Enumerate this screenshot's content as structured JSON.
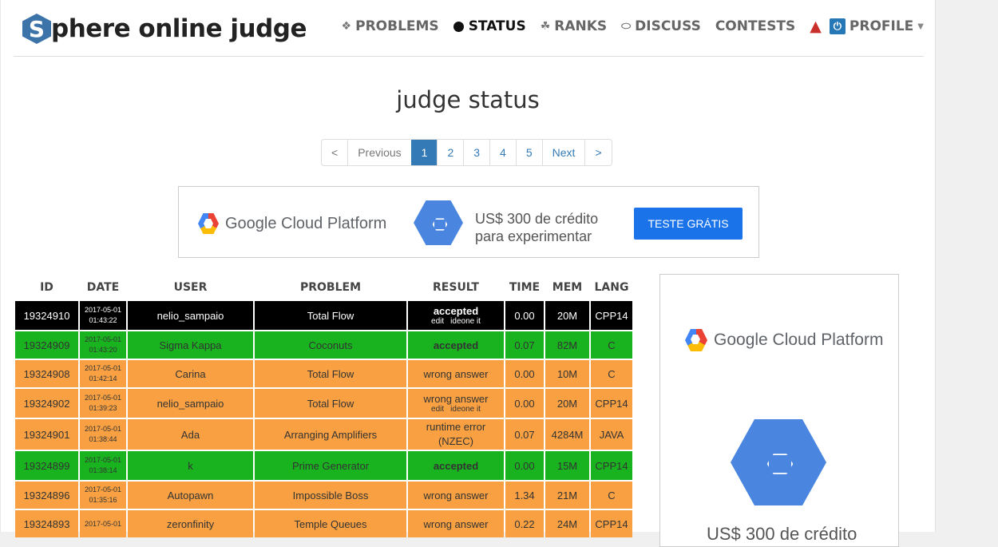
{
  "logo": {
    "letter": "S",
    "text": "phere online judge"
  },
  "nav": [
    {
      "label": "PROBLEMS",
      "icon": "puzzle-icon"
    },
    {
      "label": "STATUS",
      "icon": "dot-icon",
      "active": true
    },
    {
      "label": "RANKS",
      "icon": "trophy-icon"
    },
    {
      "label": "DISCUSS",
      "icon": "comments-icon"
    },
    {
      "label": "CONTESTS",
      "icon": ""
    },
    {
      "label": "PROFILE",
      "icon": "power-icon"
    }
  ],
  "title": "judge status",
  "pagination": [
    "<",
    "Previous",
    "1",
    "2",
    "3",
    "4",
    "5",
    "Next",
    ">"
  ],
  "ad_banner": {
    "brand": "Google Cloud Platform",
    "line1": "US$ 300 de crédito",
    "line2": "para experimentar",
    "cta": "TESTE GRÁTIS"
  },
  "ad_side": {
    "brand": "Google Cloud Platform",
    "line1": "US$ 300 de crédito"
  },
  "table": {
    "headers": [
      "ID",
      "DATE",
      "USER",
      "PROBLEM",
      "RESULT",
      "TIME",
      "MEM",
      "LANG"
    ],
    "rows": [
      {
        "id": "19324910",
        "date": "2017-05-01",
        "time_of_day": "01:43:22",
        "user": "nelio_sampaio",
        "problem": "Total Flow",
        "result": "accepted",
        "links": [
          "edit",
          "ideone it"
        ],
        "time": "0.00",
        "mem": "20M",
        "lang": "CPP14",
        "color": "black"
      },
      {
        "id": "19324909",
        "date": "2017-05-01",
        "time_of_day": "01:43:20",
        "user": "Sigma Kappa",
        "problem": "Coconuts",
        "result": "accepted",
        "links": [],
        "time": "0.07",
        "mem": "82M",
        "lang": "C",
        "color": "green"
      },
      {
        "id": "19324908",
        "date": "2017-05-01",
        "time_of_day": "01:42:14",
        "user": "Carina",
        "problem": "Total Flow",
        "result": "wrong answer",
        "links": [],
        "time": "0.00",
        "mem": "10M",
        "lang": "C",
        "color": "orange"
      },
      {
        "id": "19324902",
        "date": "2017-05-01",
        "time_of_day": "01:39:23",
        "user": "nelio_sampaio",
        "problem": "Total Flow",
        "result": "wrong answer",
        "links": [
          "edit",
          "ideone it"
        ],
        "time": "0.00",
        "mem": "20M",
        "lang": "CPP14",
        "color": "orange"
      },
      {
        "id": "19324901",
        "date": "2017-05-01",
        "time_of_day": "01:38:44",
        "user": "Ada",
        "problem": "Arranging Amplifiers",
        "result": "runtime error (NZEC)",
        "links": [],
        "time": "0.07",
        "mem": "4284M",
        "lang": "JAVA",
        "color": "orange"
      },
      {
        "id": "19324899",
        "date": "2017-05-01",
        "time_of_day": "01:38:14",
        "user": "k",
        "problem": "Prime Generator",
        "result": "accepted",
        "links": [],
        "time": "0.00",
        "mem": "15M",
        "lang": "CPP14",
        "color": "green"
      },
      {
        "id": "19324896",
        "date": "2017-05-01",
        "time_of_day": "01:35:16",
        "user": "Autopawn",
        "problem": "Impossible Boss",
        "result": "wrong answer",
        "links": [],
        "time": "1.34",
        "mem": "21M",
        "lang": "C",
        "color": "orange"
      },
      {
        "id": "19324893",
        "date": "2017-05-01",
        "time_of_day": "",
        "user": "zeronfinity",
        "problem": "Temple Queues",
        "result": "wrong answer",
        "links": [],
        "time": "0.22",
        "mem": "24M",
        "lang": "CPP14",
        "color": "orange"
      }
    ]
  }
}
